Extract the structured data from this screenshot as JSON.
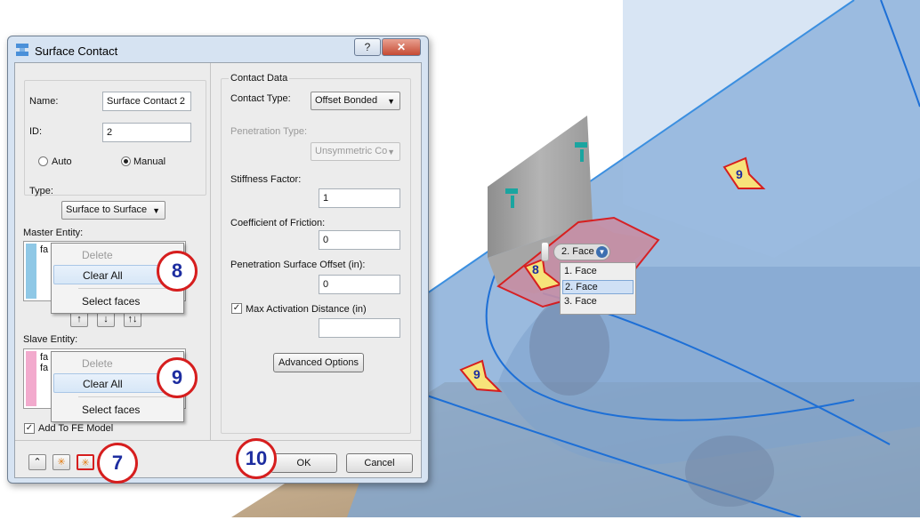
{
  "dialog": {
    "title": "Surface Contact",
    "help_label": "?",
    "close_label": "✕",
    "name_label": "Name:",
    "name_value": "Surface Contact 2",
    "id_label": "ID:",
    "id_value": "2",
    "auto_label": "Auto",
    "manual_label": "Manual",
    "type_label": "Type:",
    "type_value": "Surface to Surface",
    "master_label": "Master Entity:",
    "master_list_text": "fa",
    "slave_label": "Slave Entity:",
    "slave_list_text_1": "fa",
    "slave_list_text_2": "fa",
    "move_buttons": [
      "↑",
      "↓",
      "↑↓"
    ],
    "add_fe_label": "Add To FE Model",
    "ok_label": "OK",
    "cancel_label": "Cancel",
    "contact": {
      "group_label": "Contact Data",
      "type_label": "Contact Type:",
      "type_value": "Offset Bonded",
      "penetration_label": "Penetration Type:",
      "penetration_value": "Unsymmetric Co",
      "stiffness_label": "Stiffness Factor:",
      "stiffness_value": "1",
      "friction_label": "Coefficient of Friction:",
      "friction_value": "0",
      "offset_label": "Penetration Surface Offset (in):",
      "offset_value": "0",
      "max_activation_label": "Max Activation Distance (in)",
      "max_activation_value": "",
      "advanced_label": "Advanced Options"
    }
  },
  "menu_master": {
    "delete": "Delete",
    "clear_all": "Clear All",
    "select_faces": "Select faces"
  },
  "menu_slave": {
    "delete": "Delete",
    "clear_all": "Clear All",
    "select_faces": "Select faces"
  },
  "callouts": {
    "c7": "7",
    "c8": "8",
    "c9": "9",
    "c10": "10"
  },
  "viewport": {
    "face_pill": "2. Face",
    "face_options": [
      "1. Face",
      "2. Face",
      "3. Face"
    ],
    "arrow_labels": {
      "a8": "8",
      "a9_top": "9",
      "a9_bottom": "9"
    }
  },
  "colors": {
    "cylinder": "#7fa7d6",
    "face_highlight": "#c58a9c",
    "callout_border": "#d61e1e",
    "callout_text": "#1d2da0",
    "arrow_fill": "#f7e37a"
  }
}
